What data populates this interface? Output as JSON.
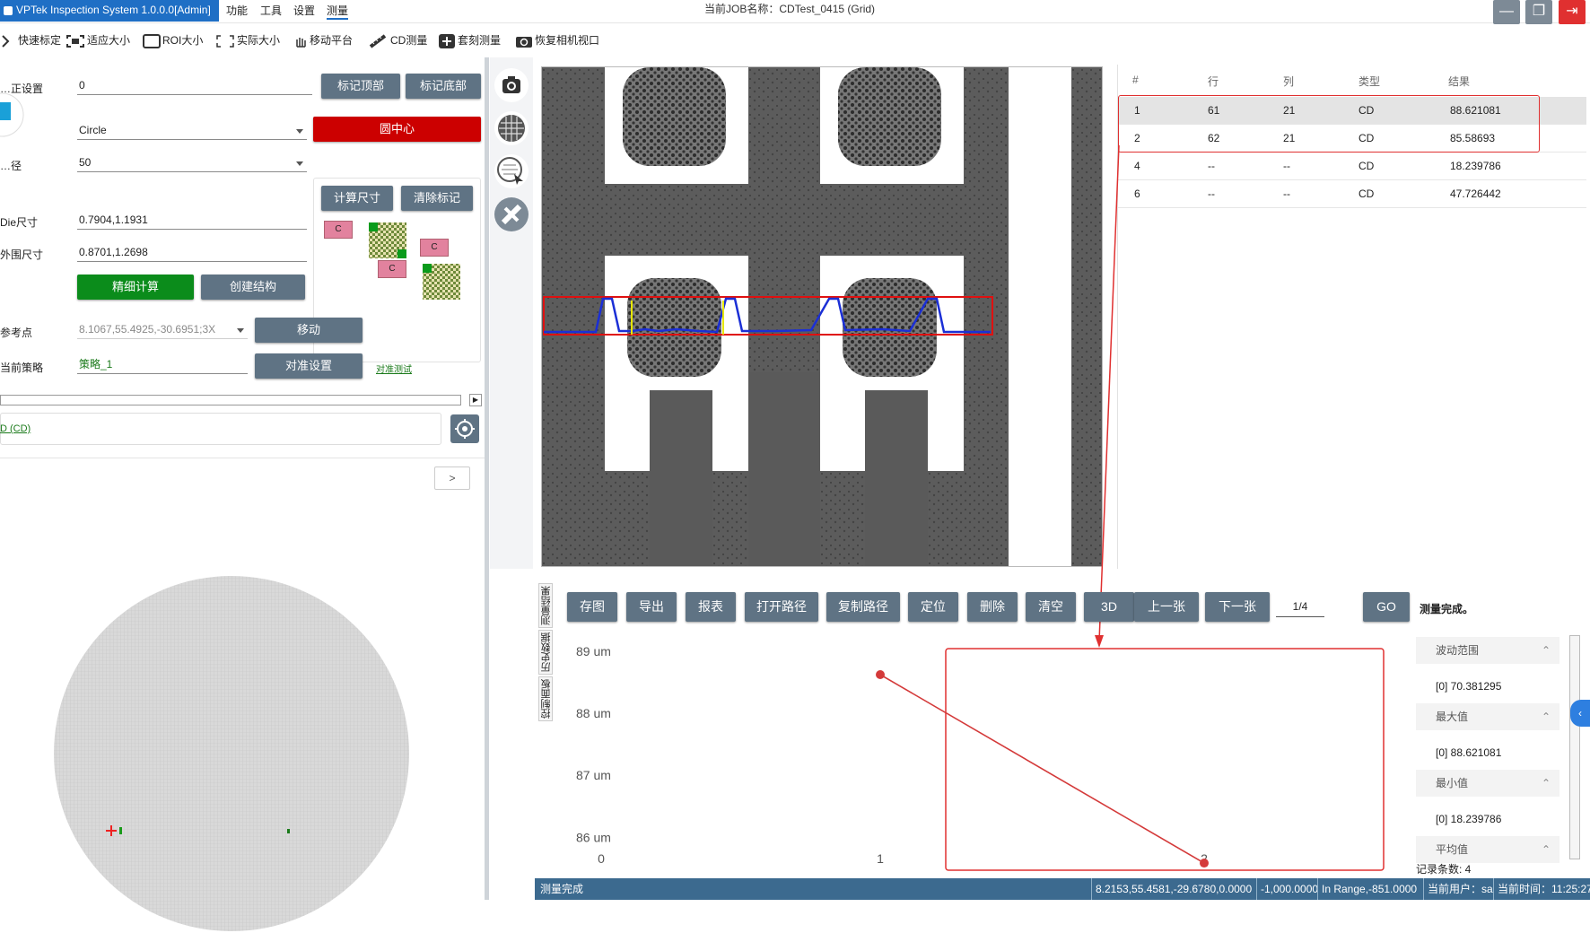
{
  "titlebar": {
    "app_title": "VPTek Inspection System 1.0.0.0[Admin]",
    "menus": [
      "功能",
      "工具",
      "设置",
      "测量"
    ],
    "job_title": "当前JOB名称：CDTest_0415 (Grid)"
  },
  "toolbar": {
    "items": [
      "快速标定",
      "适应大小",
      "ROI大小",
      "实际大小",
      "移动平台",
      "CD测量",
      "套刻测量",
      "恢复相机视口"
    ]
  },
  "left": {
    "row1_label": "…正设置",
    "row1_value": "0",
    "mark_top": "标记顶部",
    "mark_bottom": "标记底部",
    "shape_value": "Circle",
    "circle_center": "圆中心",
    "radius_label": "…径",
    "radius_value": "50",
    "calc_size": "计算尺寸",
    "clear_marks": "清除标记",
    "die_label": "Die尺寸",
    "die_value": "0.7904,1.1931",
    "outer_label": "外围尺寸",
    "outer_value": "0.8701,1.2698",
    "fine_calc": "精细计算",
    "create_struct": "创建结构",
    "ref_label": "参考点",
    "ref_value": "8.1067,55.4925,-30.6951;3X",
    "move": "移动",
    "strategy_label": "当前策略",
    "strategy_value": "策略_1",
    "align_settings": "对准设置",
    "align_test": "对准测试",
    "cd_item": "D (CD)",
    "expand": ">",
    "c_tag": "C"
  },
  "results": {
    "headers": [
      "#",
      "行",
      "列",
      "类型",
      "结果"
    ],
    "rows": [
      {
        "id": "1",
        "row": "61",
        "col": "21",
        "type": "CD",
        "result": "88.621081"
      },
      {
        "id": "2",
        "row": "62",
        "col": "21",
        "type": "CD",
        "result": "85.58693"
      },
      {
        "id": "4",
        "row": "--",
        "col": "--",
        "type": "CD",
        "result": "18.239786"
      },
      {
        "id": "6",
        "row": "--",
        "col": "--",
        "type": "CD",
        "result": "47.726442"
      }
    ]
  },
  "actions": {
    "buttons": [
      "存图",
      "导出",
      "报表",
      "打开路径",
      "复制路径",
      "定位",
      "删除",
      "清空",
      "3D",
      "上一张",
      "下一张"
    ],
    "page": "1/4",
    "go": "GO",
    "status": "测量完成。"
  },
  "tabs": [
    "测量结果",
    "历史数据",
    "控制面板"
  ],
  "chart_data": {
    "type": "line",
    "x": [
      1,
      2
    ],
    "series": [
      {
        "values": [
          88.621081,
          85.58693
        ]
      }
    ],
    "xticks": [
      "0",
      "1",
      "2"
    ],
    "yticks": [
      "89 um",
      "88 um",
      "87 um",
      "86 um"
    ],
    "xlim": [
      0,
      2
    ],
    "ylim": [
      85.4,
      89.3
    ],
    "color": "#d43a3a"
  },
  "stats": {
    "range_label": "波动范围",
    "range_value": "[0]   70.381295",
    "max_label": "最大值",
    "max_value": "[0]   88.621081",
    "min_label": "最小值",
    "min_value": "[0]   18.239786",
    "avg_label": "平均值",
    "count": "记录条数: 4"
  },
  "statusbar": {
    "left": "测量完成",
    "coords": "8.2153,55.4581,-29.6780,0.0000",
    "z": "-1,000.0000",
    "range": "In Range,-851.0000",
    "user": "当前用户：sa",
    "time": "当前时间：11:25:27"
  }
}
